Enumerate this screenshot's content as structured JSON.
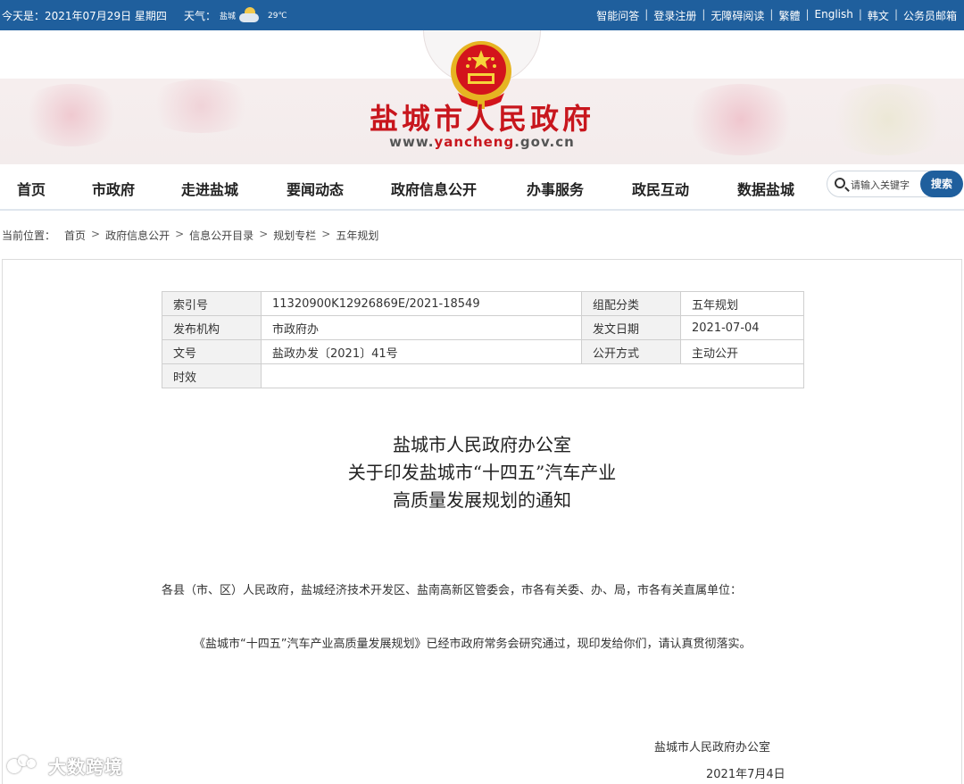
{
  "topbar": {
    "date": "今天是：2021年07月29日 星期四",
    "weather_label": "天气：",
    "weather_city": "盐城",
    "weather_temp": "29℃",
    "links": [
      "智能问答",
      "登录注册",
      "无障碍阅读",
      "繁體",
      "English",
      "韩文",
      "公务员邮箱"
    ]
  },
  "banner": {
    "title": "盐城市人民政府",
    "url_prefix": "www.",
    "url_brand": "yancheng",
    "url_suffix": ".gov.cn",
    "emblem_icon": "national-emblem-icon"
  },
  "nav": {
    "items": [
      "首页",
      "市政府",
      "走进盐城",
      "要闻动态",
      "政府信息公开",
      "办事服务",
      "政民互动",
      "数据盐城"
    ],
    "search_placeholder": "请输入关键字",
    "search_button": "搜索"
  },
  "breadcrumb": {
    "label": "当前位置：",
    "items": [
      "首页",
      "政府信息公开",
      "信息公开目录",
      "规划专栏",
      "五年规划"
    ]
  },
  "meta": {
    "index_label": "索引号",
    "index_value": "11320900K12926869E/2021-18549",
    "category_label": "组配分类",
    "category_value": "五年规划",
    "publisher_label": "发布机构",
    "publisher_value": "市政府办",
    "date_label": "发文日期",
    "date_value": "2021-07-04",
    "docno_label": "文号",
    "docno_value": "盐政办发〔2021〕41号",
    "method_label": "公开方式",
    "method_value": "主动公开",
    "validity_label": "时效",
    "validity_value": ""
  },
  "doc": {
    "title_line1": "盐城市人民政府办公室",
    "title_line2": "关于印发盐城市“十四五”汽车产业",
    "title_line3": "高质量发展规划的通知",
    "para1": "各县（市、区）人民政府，盐城经济技术开发区、盐南高新区管委会，市各有关委、办、局，市各有关直属单位：",
    "para2": "《盐城市“十四五”汽车产业高质量发展规划》已经市政府常务会研究通过，现印发给你们，请认真贯彻落实。",
    "signature": "盐城市人民政府办公室",
    "sign_date": "2021年7月4日"
  },
  "watermark": {
    "text": "大数跨境"
  },
  "colors": {
    "primary_blue": "#1f5f9d",
    "title_red": "#c8161d"
  }
}
